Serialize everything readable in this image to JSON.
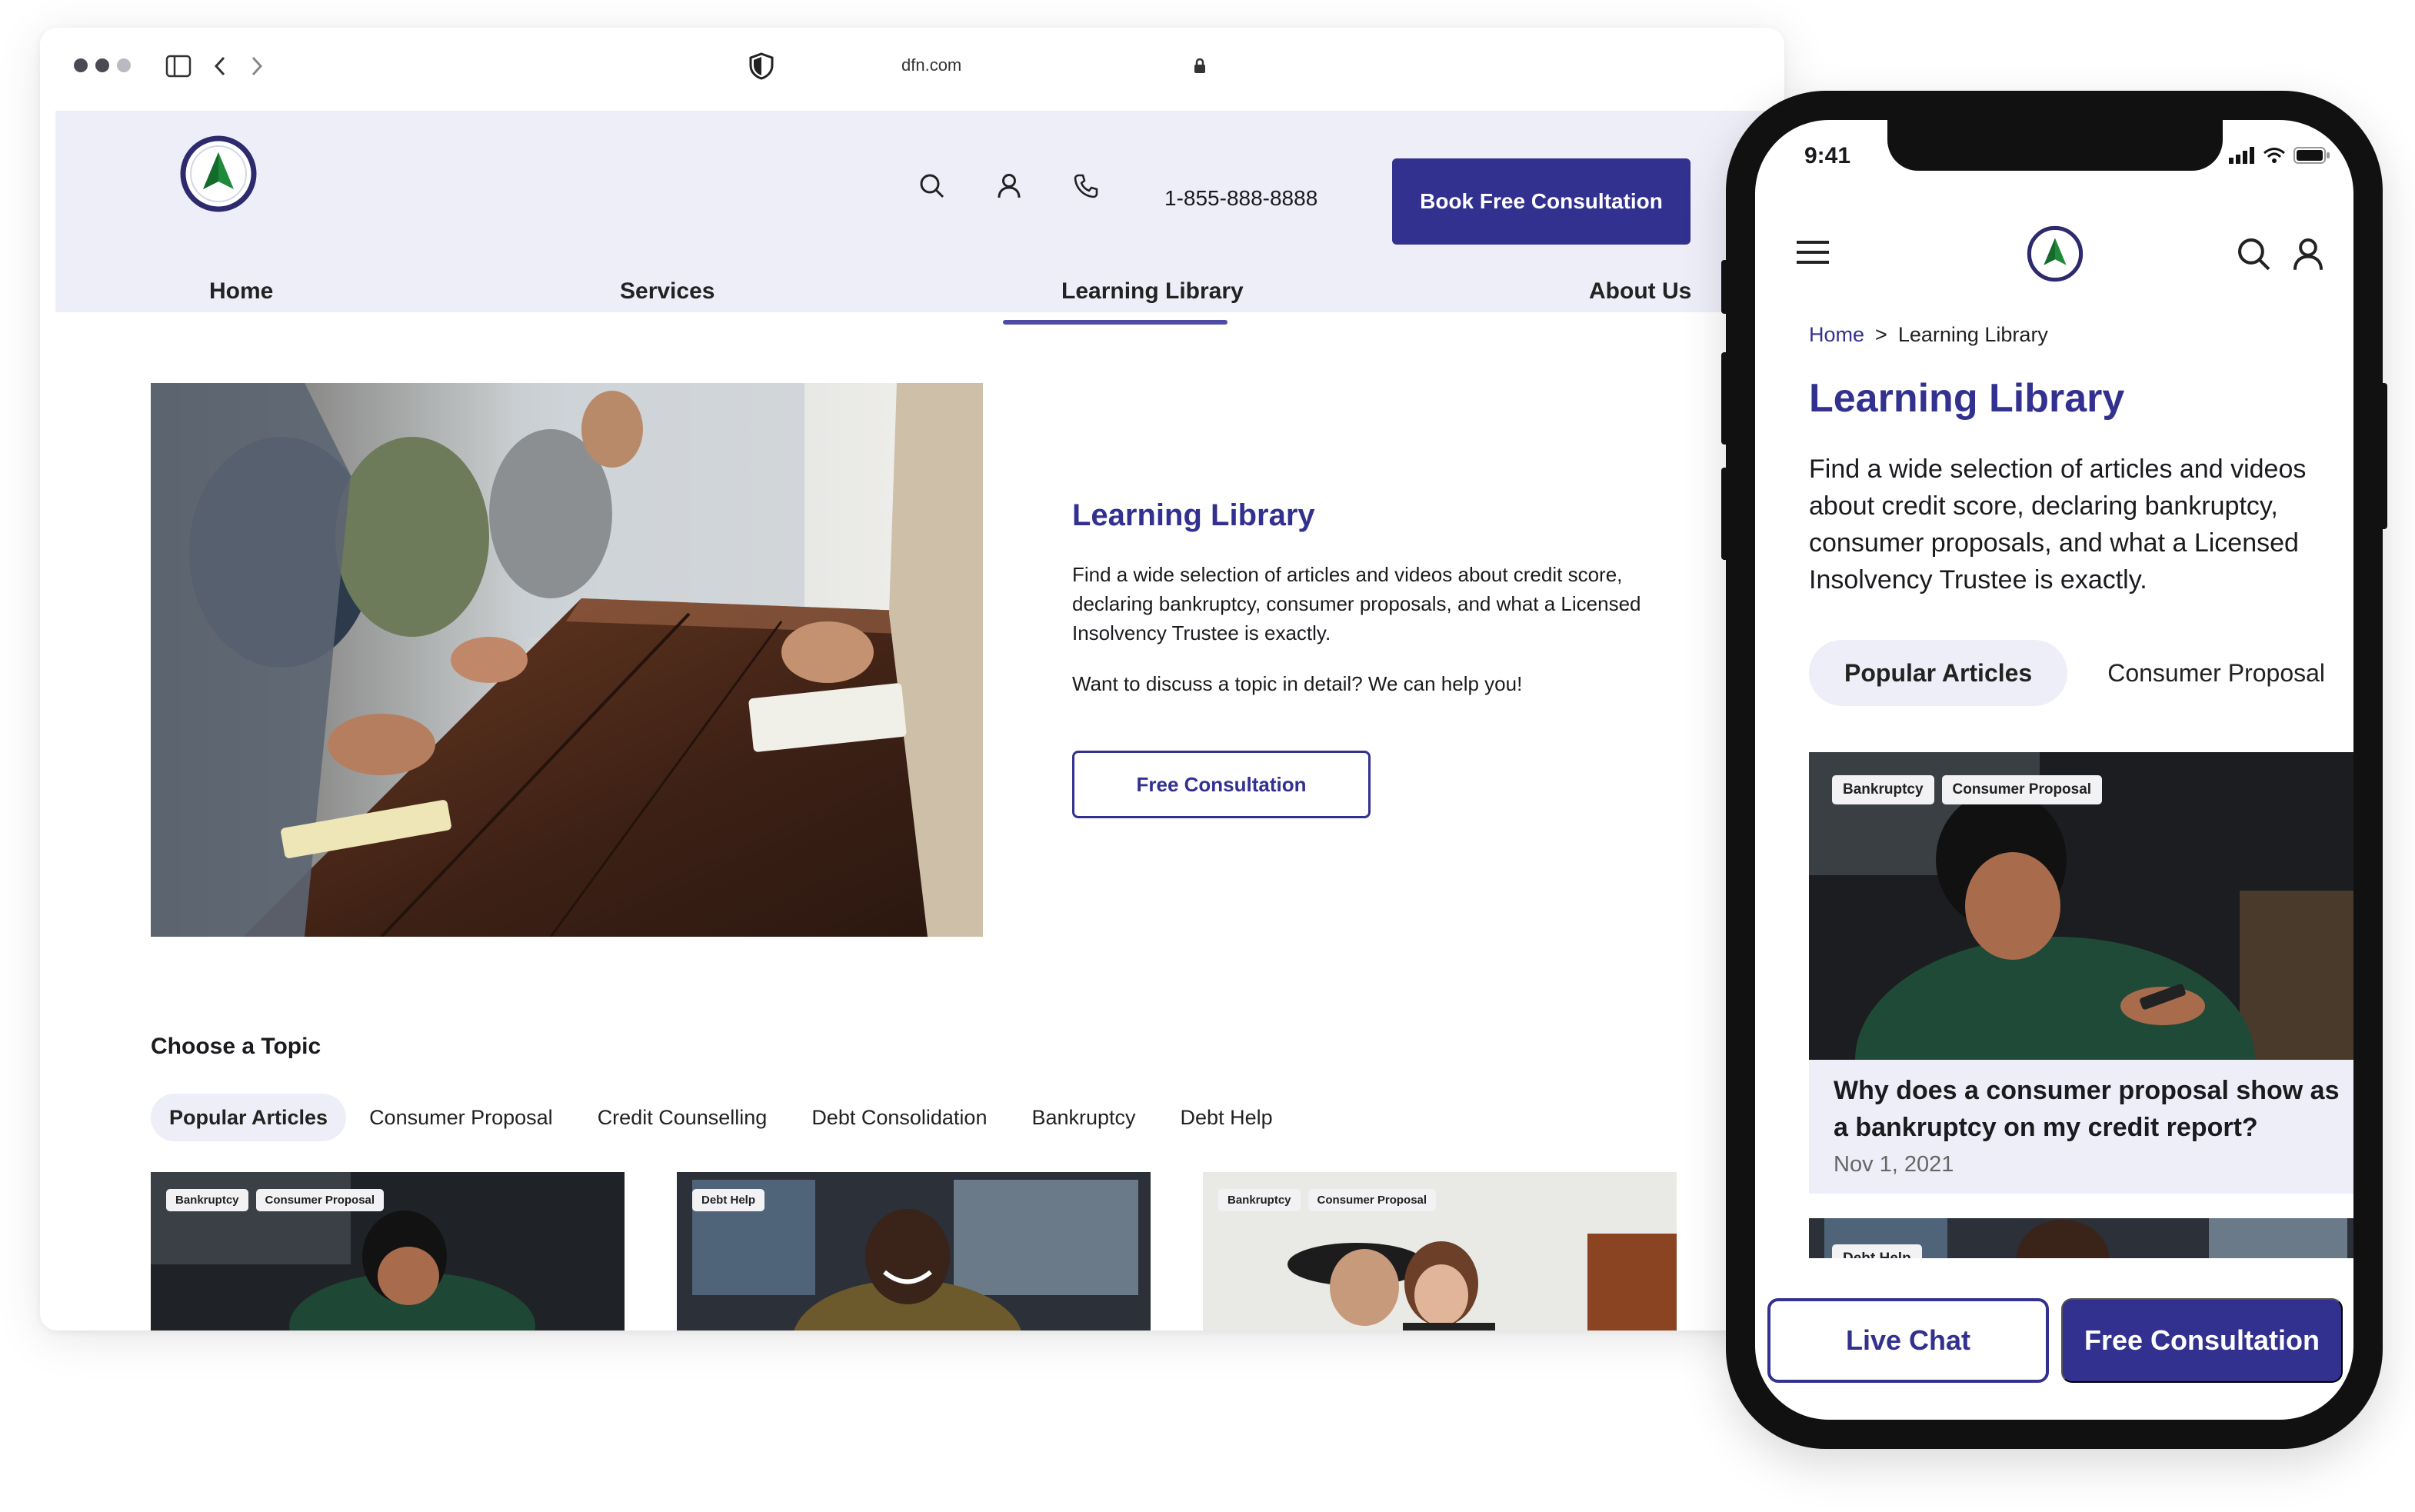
{
  "browser": {
    "url": "dfn.com",
    "header": {
      "phone": "1-855-888-8888",
      "book_label": "Book Free Consultation",
      "nav": [
        "Home",
        "Services",
        "Learning Library",
        "About Us"
      ]
    },
    "hero": {
      "title": "Learning Library",
      "description": "Find a wide selection of articles and videos about credit score, declaring bankruptcy, consumer proposals, and what a Licensed Insolvency Trustee is exactly.",
      "description2": "Want to discuss a topic in detail? We can help you!",
      "cta_label": "Free Consultation"
    },
    "topics": {
      "heading": "Choose a Topic",
      "items": [
        "Popular Articles",
        "Consumer Proposal",
        "Credit Counselling",
        "Debt Consolidation",
        "Bankruptcy",
        "Debt Help"
      ]
    },
    "cards": [
      {
        "tags": [
          "Bankruptcy",
          "Consumer Proposal"
        ]
      },
      {
        "tags": [
          "Debt Help"
        ]
      },
      {
        "tags": [
          "Bankruptcy",
          "Consumer Proposal"
        ]
      }
    ]
  },
  "phone": {
    "time": "9:41",
    "breadcrumb": {
      "home": "Home",
      "sep": ">",
      "current": "Learning Library"
    },
    "title": "Learning Library",
    "description": "Find a wide selection of articles and videos about credit score, declaring bankruptcy, consumer proposals, and what a Licensed Insolvency Trustee is exactly.",
    "tabs": [
      "Popular Articles",
      "Consumer Proposal"
    ],
    "card": {
      "tags": [
        "Bankruptcy",
        "Consumer Proposal"
      ],
      "title": "Why does a consumer proposal show as a bankruptcy on my credit report?",
      "date": "Nov 1, 2021"
    },
    "card2_tag": "Debt Help",
    "live_chat_label": "Live Chat",
    "free_label": "Free Consultation"
  },
  "colors": {
    "brand": "#33318f",
    "header_bg": "#eeeef8",
    "logo_green": "#1e8a3a"
  }
}
